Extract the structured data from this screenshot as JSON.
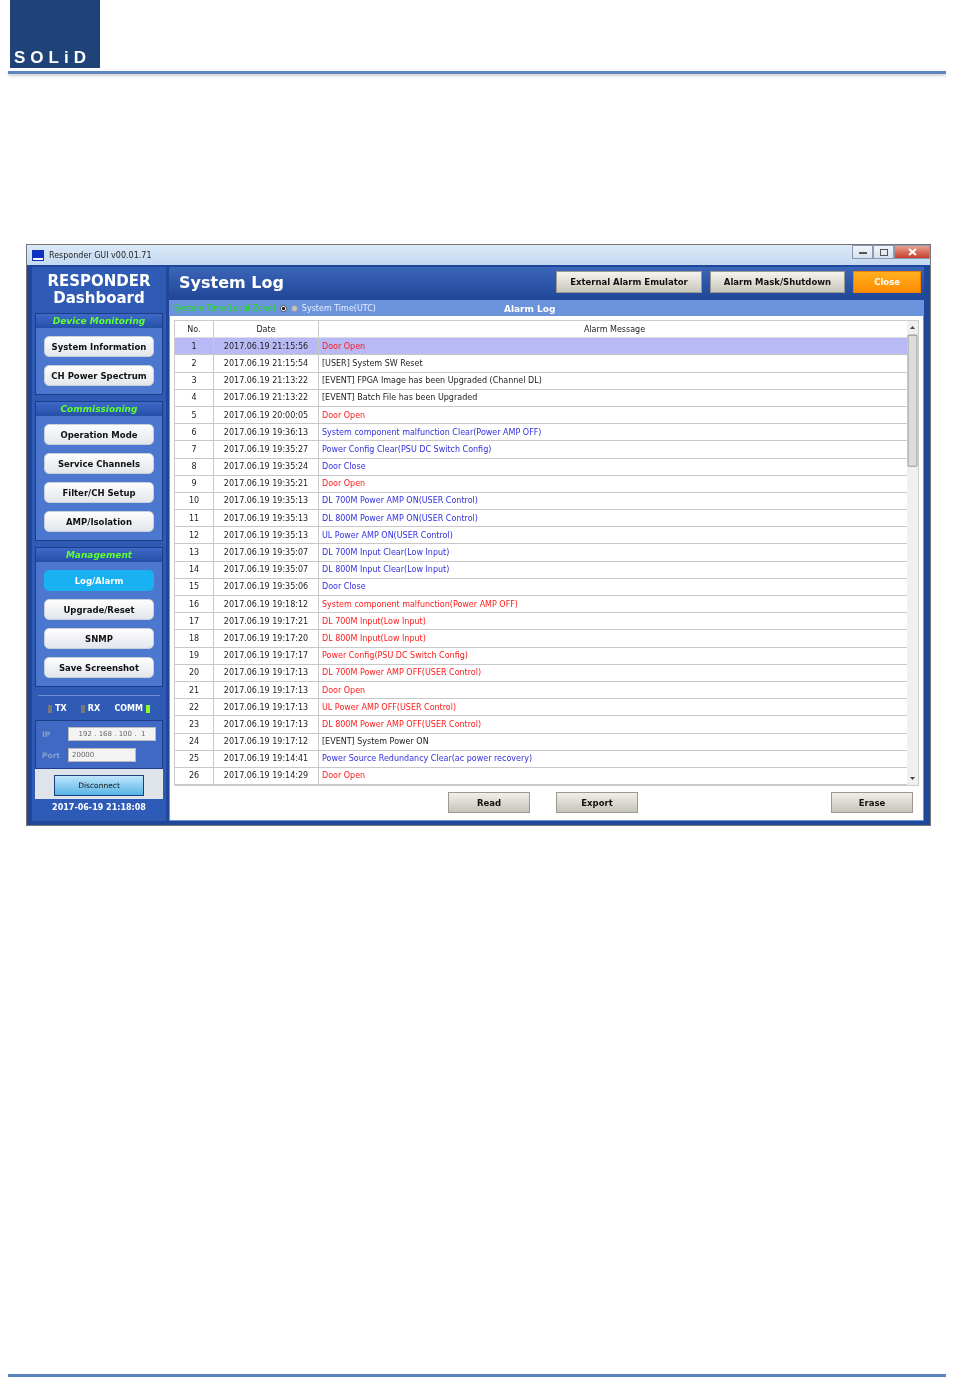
{
  "header": {
    "logo": "SOLiD"
  },
  "window": {
    "title": "Responder GUI v00.01.71"
  },
  "sidebar": {
    "title_line_1": "RESPONDER",
    "title_line_2": "Dashboard",
    "sections": [
      {
        "title": "Device Monitoring",
        "items": [
          {
            "label": "System Information",
            "selected": false
          },
          {
            "label": "CH Power Spectrum",
            "selected": false
          }
        ]
      },
      {
        "title": "Commissioning",
        "items": [
          {
            "label": "Operation Mode",
            "selected": false
          },
          {
            "label": "Service Channels",
            "selected": false
          },
          {
            "label": "Filter/CH Setup",
            "selected": false
          },
          {
            "label": "AMP/Isolation",
            "selected": false
          }
        ]
      },
      {
        "title": "Management",
        "items": [
          {
            "label": "Log/Alarm",
            "selected": true
          },
          {
            "label": "Upgrade/Reset",
            "selected": false
          },
          {
            "label": "SNMP",
            "selected": false
          },
          {
            "label": "Save Screenshot",
            "selected": false
          }
        ]
      }
    ],
    "indicators": [
      {
        "label": "TX",
        "on": false,
        "kind": "leading"
      },
      {
        "label": "RX",
        "on": false,
        "kind": "leading"
      },
      {
        "label": "COMM",
        "on": true,
        "kind": "trailing"
      }
    ],
    "connection": {
      "ip_label": "IP",
      "ip": "192 . 168 . 100 .  1",
      "port_label": "Port",
      "port": "20000",
      "button": "Disconnect"
    },
    "clock": "2017-06-19 21:18:08"
  },
  "main": {
    "title": "System Log",
    "buttons": [
      {
        "label": "External Alarm Emulator",
        "kind": "normal"
      },
      {
        "label": "Alarm Mask/Shutdown",
        "kind": "normal"
      },
      {
        "label": "Close",
        "kind": "accent"
      }
    ],
    "time_options": [
      {
        "label": "System Time(Local Zone)",
        "selected": true
      },
      {
        "label": "System Time(UTC)",
        "selected": false
      }
    ],
    "panel_title": "Alarm Log",
    "table": {
      "columns": [
        "No.",
        "Date",
        "Alarm Message"
      ],
      "rows": [
        {
          "no": "1",
          "date": "2017.06.19 21:15:56",
          "message": "Door Open",
          "kind": "alarm",
          "selected": true
        },
        {
          "no": "2",
          "date": "2017.06.19 21:15:54",
          "message": "[USER] System SW Reset",
          "kind": "event",
          "selected": false
        },
        {
          "no": "3",
          "date": "2017.06.19 21:13:22",
          "message": "[EVENT] FPGA Image has been Upgraded (Channel DL)",
          "kind": "event",
          "selected": false
        },
        {
          "no": "4",
          "date": "2017.06.19 21:13:22",
          "message": "[EVENT] Batch File has been Upgraded",
          "kind": "event",
          "selected": false
        },
        {
          "no": "5",
          "date": "2017.06.19 20:00:05",
          "message": "Door Open",
          "kind": "alarm",
          "selected": false
        },
        {
          "no": "6",
          "date": "2017.06.19 19:36:13",
          "message": "System component malfunction Clear(Power AMP OFF)",
          "kind": "clear",
          "selected": false
        },
        {
          "no": "7",
          "date": "2017.06.19 19:35:27",
          "message": "Power Config Clear(PSU DC Switch Config)",
          "kind": "clear",
          "selected": false
        },
        {
          "no": "8",
          "date": "2017.06.19 19:35:24",
          "message": "Door Close",
          "kind": "clear",
          "selected": false
        },
        {
          "no": "9",
          "date": "2017.06.19 19:35:21",
          "message": "Door Open",
          "kind": "alarm",
          "selected": false
        },
        {
          "no": "10",
          "date": "2017.06.19 19:35:13",
          "message": "DL 700M Power AMP ON(USER Control)",
          "kind": "clear",
          "selected": false
        },
        {
          "no": "11",
          "date": "2017.06.19 19:35:13",
          "message": "DL 800M Power AMP ON(USER Control)",
          "kind": "clear",
          "selected": false
        },
        {
          "no": "12",
          "date": "2017.06.19 19:35:13",
          "message": "UL Power AMP ON(USER Control)",
          "kind": "clear",
          "selected": false
        },
        {
          "no": "13",
          "date": "2017.06.19 19:35:07",
          "message": "DL 700M Input Clear(Low Input)",
          "kind": "clear",
          "selected": false
        },
        {
          "no": "14",
          "date": "2017.06.19 19:35:07",
          "message": "DL 800M Input Clear(Low Input)",
          "kind": "clear",
          "selected": false
        },
        {
          "no": "15",
          "date": "2017.06.19 19:35:06",
          "message": "Door Close",
          "kind": "clear",
          "selected": false
        },
        {
          "no": "16",
          "date": "2017.06.19 19:18:12",
          "message": "System component malfunction(Power AMP OFF)",
          "kind": "alarm",
          "selected": false
        },
        {
          "no": "17",
          "date": "2017.06.19 19:17:21",
          "message": "DL 700M Input(Low Input)",
          "kind": "alarm",
          "selected": false
        },
        {
          "no": "18",
          "date": "2017.06.19 19:17:20",
          "message": "DL 800M Input(Low Input)",
          "kind": "alarm",
          "selected": false
        },
        {
          "no": "19",
          "date": "2017.06.19 19:17:17",
          "message": "Power Config(PSU DC Switch Config)",
          "kind": "alarm",
          "selected": false
        },
        {
          "no": "20",
          "date": "2017.06.19 19:17:13",
          "message": "DL 700M Power AMP OFF(USER Control)",
          "kind": "alarm",
          "selected": false
        },
        {
          "no": "21",
          "date": "2017.06.19 19:17:13",
          "message": "Door Open",
          "kind": "alarm",
          "selected": false
        },
        {
          "no": "22",
          "date": "2017.06.19 19:17:13",
          "message": "UL Power AMP OFF(USER Control)",
          "kind": "alarm",
          "selected": false
        },
        {
          "no": "23",
          "date": "2017.06.19 19:17:13",
          "message": "DL 800M Power AMP OFF(USER Control)",
          "kind": "alarm",
          "selected": false
        },
        {
          "no": "24",
          "date": "2017.06.19 19:17:12",
          "message": "[EVENT] System Power ON",
          "kind": "event",
          "selected": false
        },
        {
          "no": "25",
          "date": "2017.06.19 19:14:41",
          "message": "Power Source Redundancy Clear(ac power recovery)",
          "kind": "clear",
          "selected": false
        },
        {
          "no": "26",
          "date": "2017.06.19 19:14:29",
          "message": "Door Open",
          "kind": "alarm",
          "selected": false
        }
      ]
    },
    "actions": [
      "Read",
      "Export",
      "Erase"
    ]
  }
}
